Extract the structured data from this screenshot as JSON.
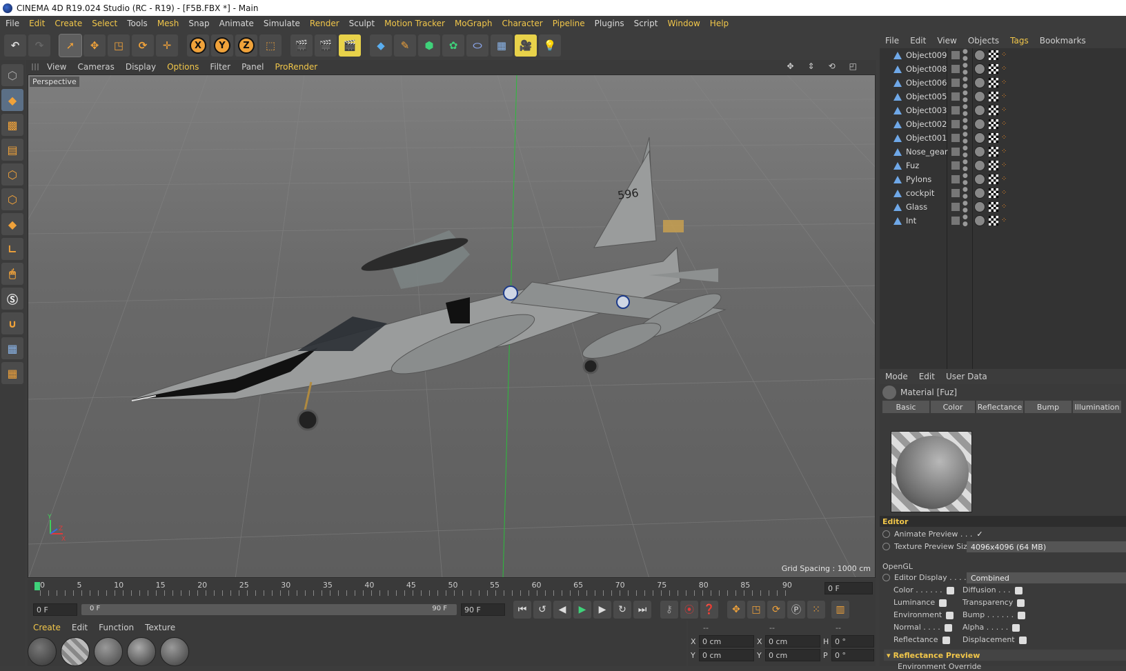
{
  "window": {
    "title": "CINEMA 4D R19.024 Studio (RC - R19) - [F5B.FBX *] - Main"
  },
  "menubar": {
    "items": [
      "File",
      "Edit",
      "Create",
      "Select",
      "Tools",
      "Mesh",
      "Snap",
      "Animate",
      "Simulate",
      "Render",
      "Sculpt",
      "Motion Tracker",
      "MoGraph",
      "Character",
      "Pipeline",
      "Plugins",
      "Script",
      "Window",
      "Help"
    ]
  },
  "toolbar": {
    "axis_x": "X",
    "axis_y": "Y",
    "axis_z": "Z"
  },
  "viewport": {
    "menu": [
      "View",
      "Cameras",
      "Display",
      "Options",
      "Filter",
      "Panel",
      "ProRender"
    ],
    "label": "Perspective",
    "grid_spacing": "Grid Spacing : 1000 cm",
    "tail_number": "596",
    "axis_y": "Y",
    "axis_x": "X",
    "axis_z": "Z"
  },
  "timeline": {
    "ticks": [
      "0",
      "5",
      "10",
      "15",
      "20",
      "25",
      "30",
      "35",
      "40",
      "45",
      "50",
      "55",
      "60",
      "65",
      "70",
      "75",
      "80",
      "85",
      "90"
    ],
    "current_frame": "0 F"
  },
  "transport": {
    "start": "0 F",
    "range_start": "0 F",
    "range_end": "90 F",
    "end": "90 F"
  },
  "material_manager": {
    "menu": [
      "Create",
      "Edit",
      "Function",
      "Texture"
    ]
  },
  "coordinates": {
    "header": [
      "--",
      "--",
      "--"
    ],
    "rows": [
      {
        "a": "X",
        "av": "0 cm",
        "b": "X",
        "bv": "0 cm",
        "c": "H",
        "cv": "0 °"
      },
      {
        "a": "Y",
        "av": "0 cm",
        "b": "Y",
        "bv": "0 cm",
        "c": "P",
        "cv": "0 °"
      }
    ]
  },
  "object_manager": {
    "menu": [
      "File",
      "Edit",
      "View",
      "Objects",
      "Tags",
      "Bookmarks"
    ],
    "objects": [
      "Object009",
      "Object008",
      "Object006",
      "Object005",
      "Object003",
      "Object002",
      "Object001",
      "Nose_gear",
      "Fuz",
      "Pylons",
      "cockpit",
      "Glass",
      "Int"
    ]
  },
  "attributes": {
    "menu": [
      "Mode",
      "Edit",
      "User Data"
    ],
    "material_title": "Material [Fuz]",
    "tabs": [
      "Basic",
      "Color",
      "Reflectance",
      "Bump",
      "Illumination"
    ],
    "editor_label": "Editor",
    "animate_preview": "Animate Preview . . .",
    "texture_preview_size": "Texture Preview Size",
    "texture_preview_value": "4096x4096 (64 MB)",
    "opengl_label": "OpenGL",
    "editor_display": "Editor Display . . . . .",
    "editor_display_value": "Combined",
    "channels_left": [
      "Color . . . . . .",
      "Luminance",
      "Environment",
      "Normal . . . .",
      "Reflectance"
    ],
    "channels_right": [
      "Diffusion . . .",
      "Transparency",
      "Bump . . . . . .",
      "Alpha . . . . .",
      "Displacement"
    ],
    "reflectance_preview": "Reflectance Preview",
    "environment_override": "Environment Override"
  }
}
